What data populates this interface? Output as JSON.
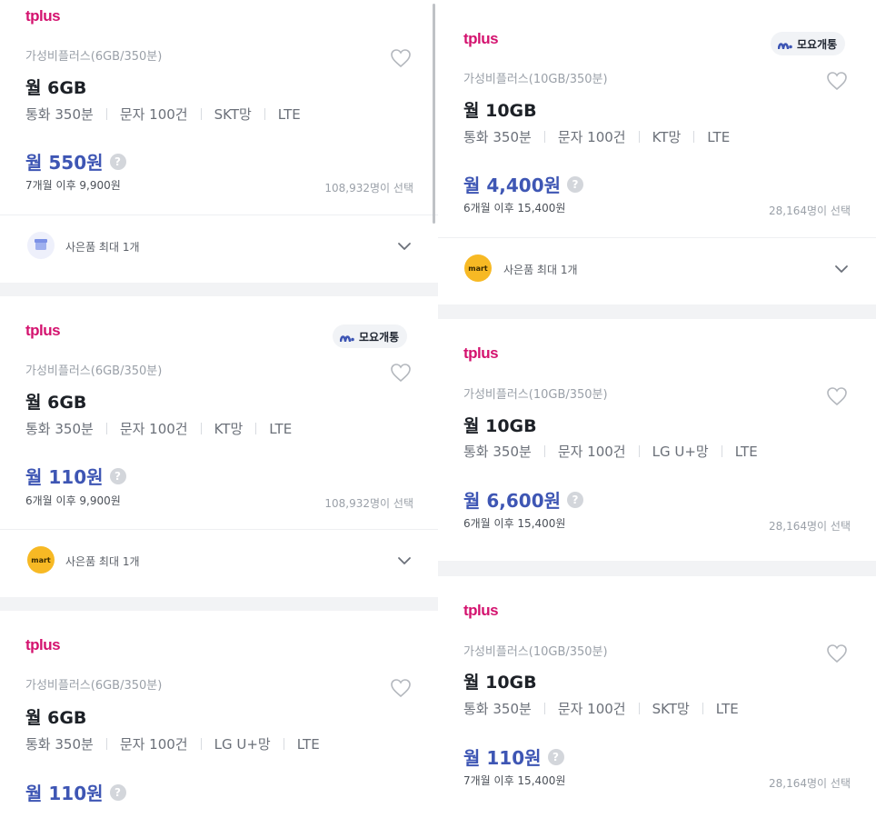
{
  "brand_color": "#d4136f",
  "price_color": "#3e56b4",
  "left_cards": [
    {
      "logo": "tplus",
      "plan_name": "가성비플러스(6GB/350분)",
      "data": "월 6GB",
      "specs": [
        "통화 350분",
        "문자 100건",
        "SKT망",
        "LTE"
      ],
      "price": "월 550원",
      "after": "7개월 이후 9,900원",
      "selected": "108,932명이 선택",
      "gift": {
        "icon": "gift-box-icon",
        "label": "사은품 최대 1개"
      }
    },
    {
      "logo": "tplus",
      "badge": "모요개통",
      "plan_name": "가성비플러스(6GB/350분)",
      "data": "월 6GB",
      "specs": [
        "통화 350분",
        "문자 100건",
        "KT망",
        "LTE"
      ],
      "price": "월 110원",
      "after": "6개월 이후 9,900원",
      "selected": "108,932명이 선택",
      "gift": {
        "icon": "emart-icon",
        "label": "사은품 최대 1개",
        "icon_text": "mart"
      }
    },
    {
      "logo": "tplus",
      "plan_name": "가성비플러스(6GB/350분)",
      "data": "월 6GB",
      "specs": [
        "통화 350분",
        "문자 100건",
        "LG U+망",
        "LTE"
      ],
      "price": "월 110원"
    }
  ],
  "right_cards": [
    {
      "logo": "tplus",
      "badge": "모요개통",
      "plan_name": "가성비플러스(10GB/350분)",
      "data": "월 10GB",
      "specs": [
        "통화 350분",
        "문자 100건",
        "KT망",
        "LTE"
      ],
      "price": "월 4,400원",
      "after": "6개월 이후 15,400원",
      "selected": "28,164명이 선택",
      "gift": {
        "icon": "emart-icon",
        "label": "사은품 최대 1개",
        "icon_text": "mart"
      }
    },
    {
      "logo": "tplus",
      "plan_name": "가성비플러스(10GB/350분)",
      "data": "월 10GB",
      "specs": [
        "통화 350분",
        "문자 100건",
        "LG U+망",
        "LTE"
      ],
      "price": "월 6,600원",
      "after": "6개월 이후 15,400원",
      "selected": "28,164명이 선택"
    },
    {
      "logo": "tplus",
      "plan_name": "가성비플러스(10GB/350분)",
      "data": "월 10GB",
      "specs": [
        "통화 350분",
        "문자 100건",
        "SKT망",
        "LTE"
      ],
      "price": "월 110원",
      "after": "7개월 이후 15,400원",
      "selected": "28,164명이 선택"
    }
  ]
}
